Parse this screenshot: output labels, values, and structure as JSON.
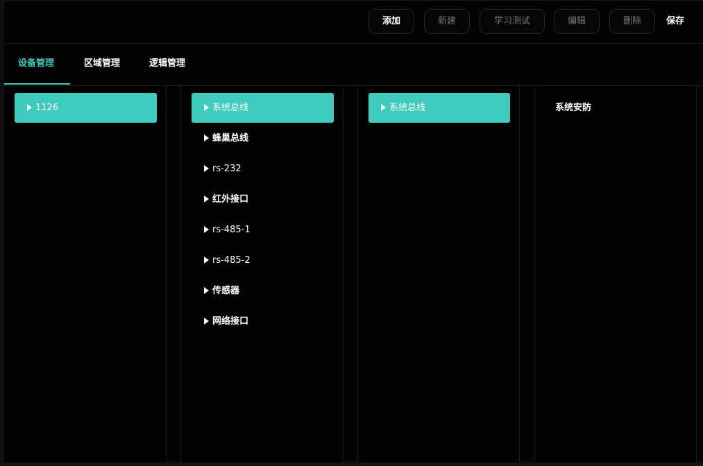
{
  "toolbar": {
    "buttons": [
      {
        "label": "添加",
        "state": "active"
      },
      {
        "label": "新建",
        "state": "disabled"
      },
      {
        "label": "学习测试",
        "state": "disabled"
      },
      {
        "label": "编辑",
        "state": "disabled"
      },
      {
        "label": "删除",
        "state": "disabled"
      }
    ],
    "save_label": "保存"
  },
  "tabs": [
    {
      "label": "设备管理",
      "active": true
    },
    {
      "label": "区域管理",
      "active": false
    },
    {
      "label": "逻辑管理",
      "active": false
    }
  ],
  "columns": {
    "devices": [
      {
        "label": "1126",
        "selected": true
      }
    ],
    "interfaces": [
      {
        "label": "系统总线",
        "selected": true
      },
      {
        "label": "蜂巢总线",
        "selected": false
      },
      {
        "label": "rs-232",
        "selected": false
      },
      {
        "label": "红外接口",
        "selected": false
      },
      {
        "label": "rs-485-1",
        "selected": false
      },
      {
        "label": "rs-485-2",
        "selected": false
      },
      {
        "label": "传感器",
        "selected": false
      },
      {
        "label": "网络接口",
        "selected": false
      }
    ],
    "sub_interfaces": [
      {
        "label": "系统总线",
        "selected": true
      }
    ],
    "functions": [
      {
        "label": "系统安防"
      }
    ]
  },
  "colors": {
    "accent": "#3ecbbb",
    "background": "#030303",
    "border": "#1e1e1e",
    "disabled_text": "#7a7a7a"
  },
  "icons": {
    "tree_item": "caret-right-icon"
  }
}
